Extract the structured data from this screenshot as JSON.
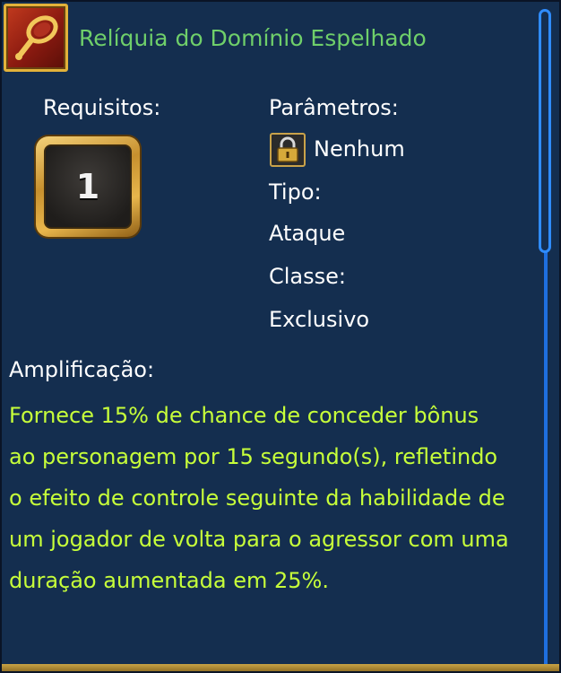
{
  "item": {
    "name": "Relíquia do Domínio Espelhado",
    "icon": "mirror-relic-icon"
  },
  "requirements": {
    "label": "Requisitos:",
    "level": "1"
  },
  "parameters": {
    "label": "Parâmetros:",
    "lock_icon": "lock-icon",
    "value": "Nenhum"
  },
  "type": {
    "label": "Tipo:",
    "value": "Ataque"
  },
  "class": {
    "label": "Classe:",
    "value": "Exclusivo"
  },
  "amplification": {
    "label": "Amplificação:",
    "text": "Fornece 15% de chance de conceder bônus ao personagem por 15 segundo(s), refletindo o efeito de controle seguinte da habilidade de um jogador de volta para o agressor com uma duração aumentada em 25%."
  },
  "colors": {
    "panel_bg": "#142e4f",
    "title": "#6fcf6a",
    "effect_text": "#c7ff3a",
    "scrollbar": "#2f8cff"
  }
}
